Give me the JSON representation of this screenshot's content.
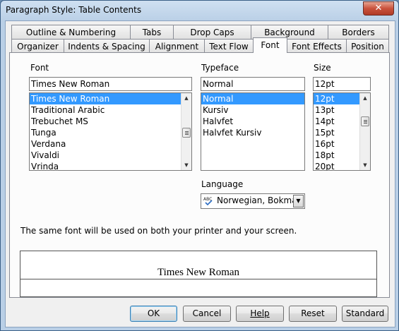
{
  "window": {
    "title": "Paragraph Style: Table Contents",
    "close_label": "✕"
  },
  "tabs_row1": [
    "Outline & Numbering",
    "Tabs",
    "Drop Caps",
    "Background",
    "Borders"
  ],
  "tabs_row2": [
    "Organizer",
    "Indents & Spacing",
    "Alignment",
    "Text Flow",
    "Font",
    "Font Effects",
    "Position"
  ],
  "active_tab": "Font",
  "font": {
    "label": "Font",
    "value": "Times New Roman",
    "items": [
      "Times New Roman",
      "Traditional Arabic",
      "Trebuchet MS",
      "Tunga",
      "Verdana",
      "Vivaldi",
      "Vrinda"
    ],
    "selected_index": 0
  },
  "typeface": {
    "label": "Typeface",
    "value": "Normal",
    "items": [
      "Normal",
      "Kursiv",
      "Halvfet",
      "Halvfet Kursiv"
    ],
    "selected_index": 0
  },
  "size": {
    "label": "Size",
    "value": "12pt",
    "items": [
      "12pt",
      "13pt",
      "14pt",
      "15pt",
      "16pt",
      "18pt",
      "20pt"
    ],
    "selected_index": 0
  },
  "language": {
    "label": "Language",
    "value": "Norwegian, Bokmål",
    "icon": "spellcheck-abc-icon"
  },
  "info_text": "The same font will be used on both your printer and your screen.",
  "preview_text": "Times New Roman",
  "buttons": {
    "ok": "OK",
    "cancel": "Cancel",
    "help": "Help",
    "reset": "Reset",
    "standard": "Standard"
  }
}
